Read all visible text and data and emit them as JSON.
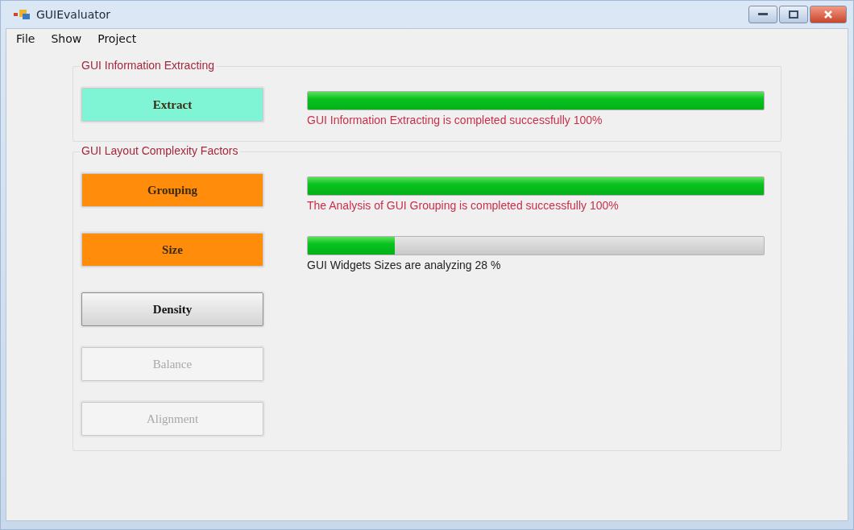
{
  "window": {
    "title": "GUIEvaluator"
  },
  "menu": [
    "File",
    "Show",
    "Project"
  ],
  "groups": [
    {
      "title": "GUI Information Extracting",
      "rows": [
        {
          "button": {
            "label": "Extract",
            "color": "#80f5d6",
            "disabled": false
          },
          "progress": {
            "level": 1,
            "message": "GUI Information Extracting is completed successfully 100%",
            "complete": true
          }
        }
      ]
    },
    {
      "title": "GUI Layout Complexity Factors",
      "rows": [
        {
          "button": {
            "label": "Grouping",
            "color": "#ff8c0a",
            "disabled": false
          },
          "progress": {
            "level": 1,
            "message": "The Analysis of GUI Grouping is completed successfully 100%",
            "complete": true
          }
        },
        {
          "button": {
            "label": "Size",
            "color": "#ff8c0a",
            "disabled": false
          },
          "progress": {
            "level": 0.19,
            "message": "GUI Widgets Sizes are analyzing 28 %",
            "complete": false
          }
        },
        {
          "button": {
            "label": "Density",
            "disabled": false
          }
        },
        {
          "button": {
            "label": "Balance",
            "disabled": true
          }
        },
        {
          "button": {
            "label": "Alignment",
            "disabled": true
          }
        }
      ]
    }
  ]
}
